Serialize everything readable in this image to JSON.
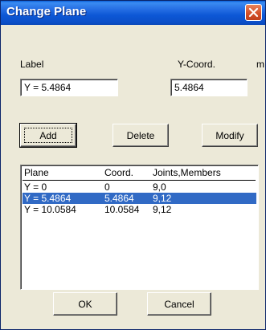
{
  "window": {
    "title": "Change Plane",
    "close_icon": "close-icon"
  },
  "labels": {
    "label": "Label",
    "coord": "Y-Coord.",
    "unit": "m"
  },
  "inputs": {
    "label_value": "Y = 5.4864",
    "coord_value": "5.4864"
  },
  "buttons": {
    "add": "Add",
    "delete": "Delete",
    "modify": "Modify",
    "ok": "OK",
    "cancel": "Cancel"
  },
  "table": {
    "headers": [
      "Plane",
      "Coord.",
      "Joints,Members"
    ],
    "rows": [
      {
        "plane": "Y = 0",
        "coord": "0",
        "jm": "9,0",
        "selected": false
      },
      {
        "plane": "Y = 5.4864",
        "coord": "5.4864",
        "jm": "9,12",
        "selected": true
      },
      {
        "plane": "Y = 10.0584",
        "coord": "10.0584",
        "jm": "9,12",
        "selected": false
      }
    ]
  },
  "colors": {
    "titlebar": "#0a5fd8",
    "selection": "#316ac5",
    "dialog_bg": "#ece9d8"
  }
}
